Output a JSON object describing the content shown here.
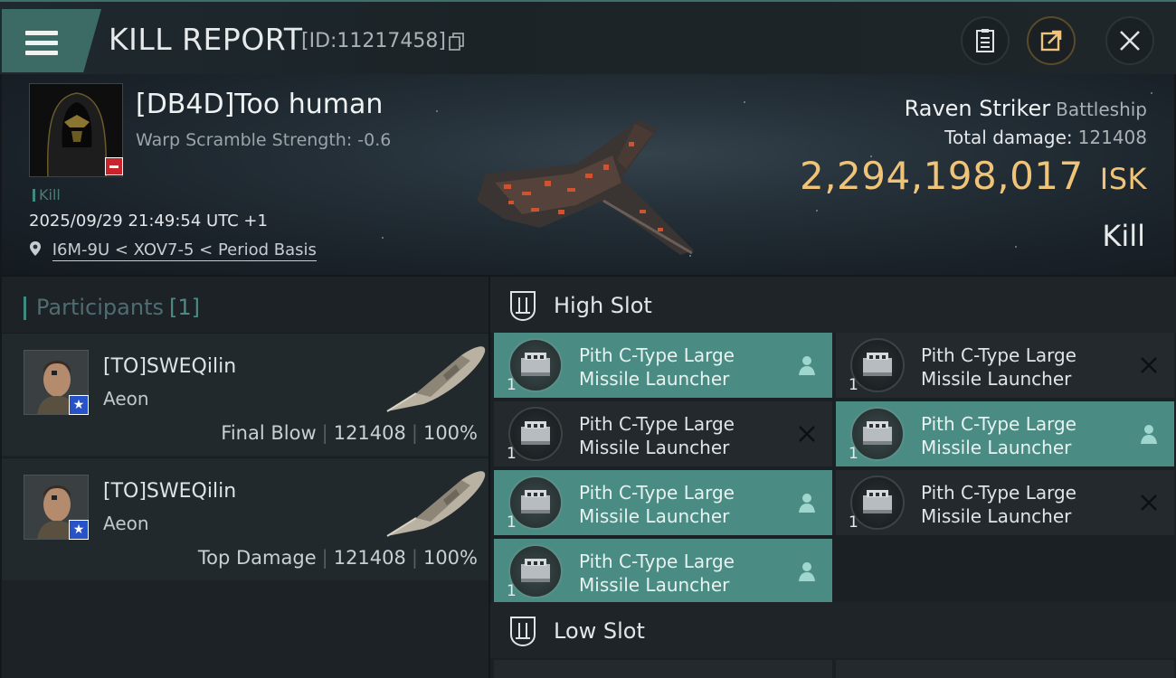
{
  "header": {
    "title": "KILL REPORT",
    "id_text": "[ID:11217458]",
    "icons": [
      "menu-icon",
      "copy-icon",
      "report-icon",
      "share-icon",
      "close-icon"
    ]
  },
  "victim": {
    "name": "[DB4D]Too human",
    "warp_scramble": "Warp Scramble Strength: -0.6",
    "kill_tag": "Kill",
    "datetime": "2025/09/29 21:49:54 UTC +1",
    "location": "I6M-9U < XOV7-5 < Period Basis"
  },
  "ship": {
    "name": "Raven Striker",
    "class": "Battleship",
    "damage_label": "Total damage:",
    "damage_value": "121408",
    "isk_value": "2,294,198,017",
    "isk_unit": "ISK",
    "result": "Kill"
  },
  "participants": {
    "title": "Participants",
    "count": "[1]",
    "rows": [
      {
        "name": "[TO]SWEQilin",
        "ship": "Aeon",
        "role": "Final Blow",
        "damage": "121408",
        "percent": "100%"
      },
      {
        "name": "[TO]SWEQilin",
        "ship": "Aeon",
        "role": "Top Damage",
        "damage": "121408",
        "percent": "100%"
      }
    ]
  },
  "slots": {
    "high": {
      "label": "High Slot",
      "modules": [
        {
          "name_line1": "Pith C-Type Large",
          "name_line2": "Missile Launcher",
          "qty": "1",
          "status": "dropped"
        },
        {
          "name_line1": "Pith C-Type Large",
          "name_line2": "Missile Launcher",
          "qty": "1",
          "status": "destroyed"
        },
        {
          "name_line1": "Pith C-Type Large",
          "name_line2": "Missile Launcher",
          "qty": "1",
          "status": "destroyed"
        },
        {
          "name_line1": "Pith C-Type Large",
          "name_line2": "Missile Launcher",
          "qty": "1",
          "status": "dropped"
        },
        {
          "name_line1": "Pith C-Type Large",
          "name_line2": "Missile Launcher",
          "qty": "1",
          "status": "dropped"
        },
        {
          "name_line1": "Pith C-Type Large",
          "name_line2": "Missile Launcher",
          "qty": "1",
          "status": "destroyed"
        },
        {
          "name_line1": "Pith C-Type Large",
          "name_line2": "Missile Launcher",
          "qty": "1",
          "status": "dropped"
        }
      ]
    },
    "low": {
      "label": "Low Slot"
    }
  },
  "colors": {
    "accent_teal": "#4a8c83",
    "isk_gold": "#f0c478",
    "danger_red": "#c8242a"
  }
}
